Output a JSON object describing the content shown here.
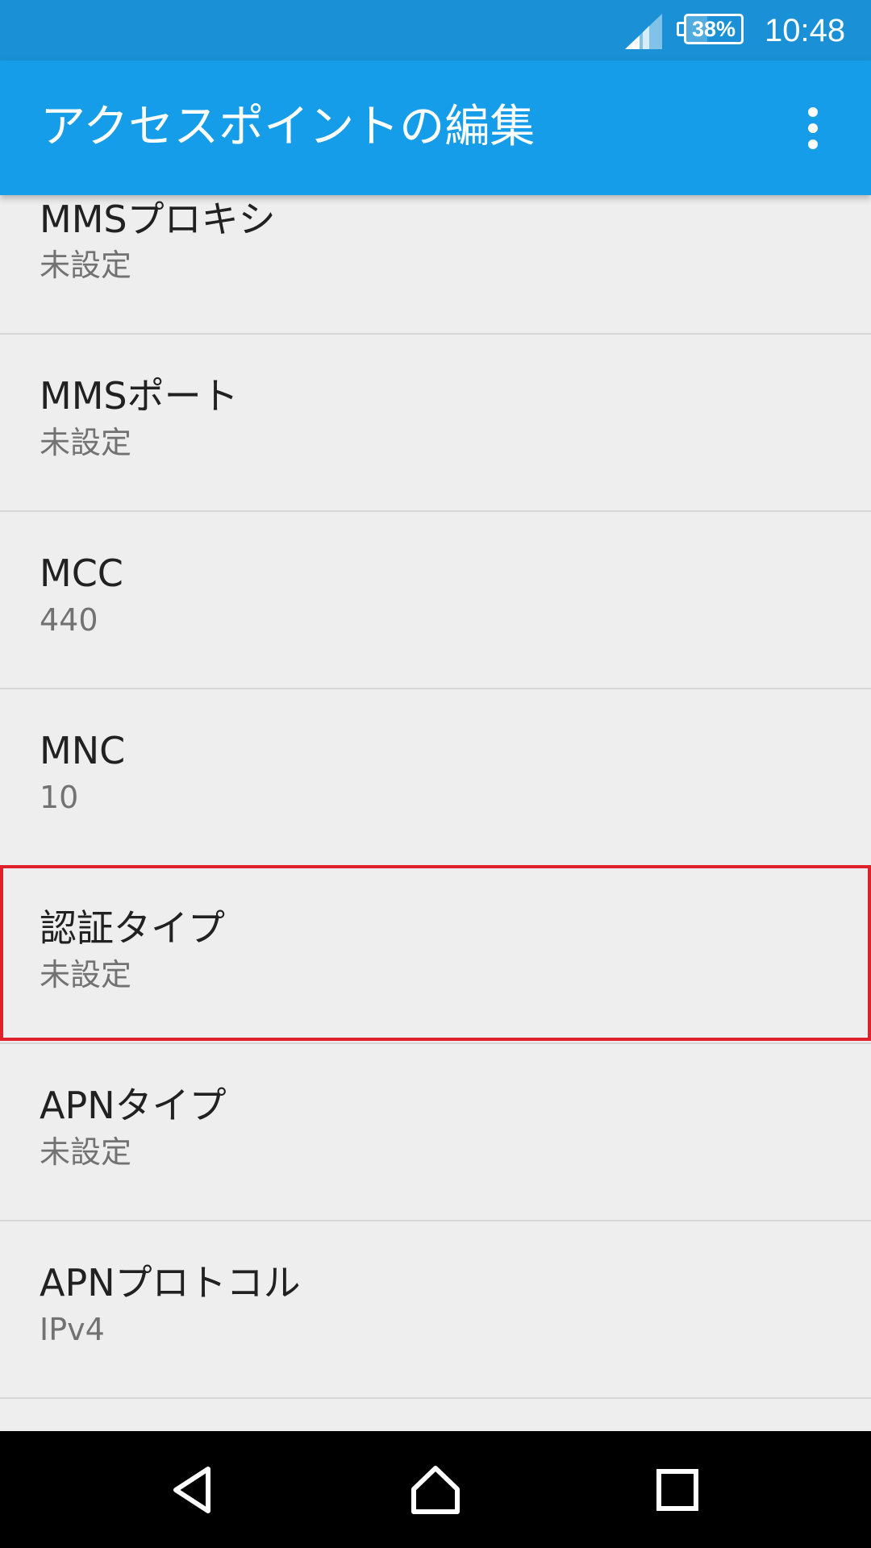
{
  "status_bar": {
    "battery_percent": "38%",
    "battery_level": 0.38,
    "time": "10:48",
    "signal_icon": "cellular-signal-icon",
    "battery_icon": "battery-icon"
  },
  "app_bar": {
    "title": "アクセスポイントの編集",
    "menu_icon": "more-vert-icon",
    "color": "#169de9"
  },
  "preferences": [
    {
      "title": "MMSプロキシ",
      "summary": "未設定"
    },
    {
      "title": "MMSポート",
      "summary": "未設定"
    },
    {
      "title": "MCC",
      "summary": "440"
    },
    {
      "title": "MNC",
      "summary": "10"
    },
    {
      "title": "認証タイプ",
      "summary": "未設定",
      "highlighted": true
    },
    {
      "title": "APNタイプ",
      "summary": "未設定"
    },
    {
      "title": "APNプロトコル",
      "summary": "IPv4"
    }
  ],
  "highlight_color": "#e0202a",
  "nav_bar": {
    "back_icon": "back-icon",
    "home_icon": "home-icon",
    "recents_icon": "recents-icon"
  }
}
